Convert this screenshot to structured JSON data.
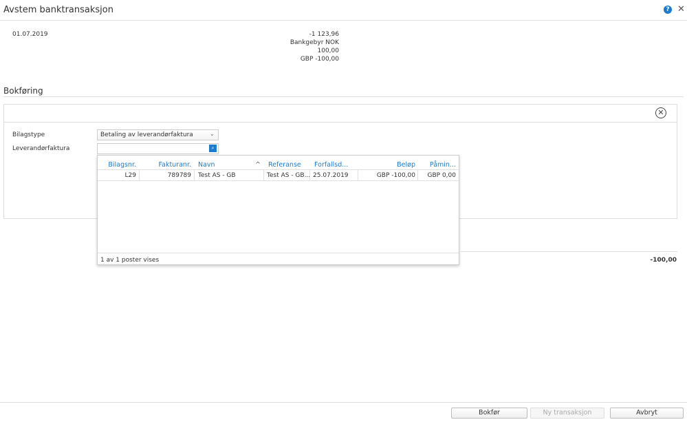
{
  "dialog": {
    "title": "Avstem banktransaksjon"
  },
  "transaction": {
    "date": "01.07.2019",
    "amount": "-1 123,96",
    "fee_label": "Bankgebyr NOK",
    "fee_amount": "100,00",
    "foreign_amount": "GBP -100,00"
  },
  "booking": {
    "section_title": "Bokføring",
    "bilagstype_label": "Bilagstype",
    "bilagstype_value": "Betaling av leverandørfaktura",
    "leverandorfaktura_label": "Leverandørfaktura",
    "leverandorfaktura_value": "",
    "total": "-100,00"
  },
  "lookup": {
    "columns": [
      "Bilagsnr.",
      "Fakturanr.",
      "Navn",
      "Referanse",
      "Forfallsd...",
      "Beløp",
      "Påmin..."
    ],
    "rows": [
      [
        "L29",
        "789789",
        "Test AS - GB",
        "Test AS - GB...",
        "25.07.2019",
        "GBP -100,00",
        "GBP 0,00"
      ]
    ],
    "footer": "1 av 1 poster vises"
  },
  "buttons": {
    "post": "Bokfør",
    "new_transaction": "Ny transaksjon",
    "cancel": "Avbryt"
  }
}
